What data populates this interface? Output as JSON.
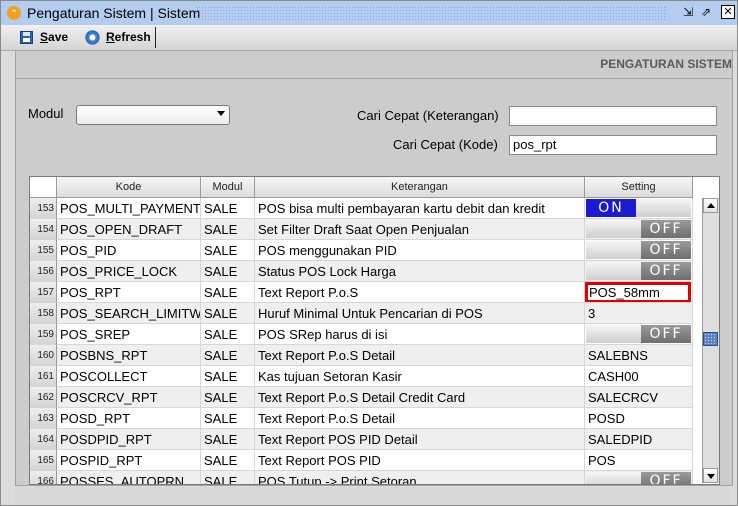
{
  "window": {
    "title": "Pengaturan Sistem | Sistem",
    "controls": {
      "minimize": "⇲",
      "maximize": "⇗",
      "close": "✕"
    }
  },
  "toolbar": {
    "save_prefix": "S",
    "save_rest": "ave",
    "refresh_prefix": "R",
    "refresh_rest": "efresh"
  },
  "panel": {
    "header": "PENGATURAN SISTEM",
    "modul_label": "Modul",
    "modul_value": "",
    "search_ket_label": "Cari Cepat (Keterangan)",
    "search_ket_value": "",
    "search_kode_label": "Cari Cepat (Kode)",
    "search_kode_value": "pos_rpt"
  },
  "table": {
    "columns": [
      "",
      "Kode",
      "Modul",
      "Keterangan",
      "Setting"
    ],
    "rows": [
      {
        "no": "153",
        "kode": "POS_MULTI_PAYMENT",
        "modul": "SALE",
        "ket": "POS bisa multi pembayaran kartu debit dan kredit",
        "type": "toggle",
        "setting": "ON"
      },
      {
        "no": "154",
        "kode": "POS_OPEN_DRAFT",
        "modul": "SALE",
        "ket": "Set Filter Draft Saat Open Penjualan",
        "type": "toggle",
        "setting": "OFF"
      },
      {
        "no": "155",
        "kode": "POS_PID",
        "modul": "SALE",
        "ket": "POS menggunakan PID",
        "type": "toggle",
        "setting": "OFF"
      },
      {
        "no": "156",
        "kode": "POS_PRICE_LOCK",
        "modul": "SALE",
        "ket": "Status POS Lock Harga",
        "type": "toggle",
        "setting": "OFF"
      },
      {
        "no": "157",
        "kode": "POS_RPT",
        "modul": "SALE",
        "ket": "Text Report P.o.S",
        "type": "text-highlight",
        "setting": "POS_58mm"
      },
      {
        "no": "158",
        "kode": "POS_SEARCH_LIMITW",
        "modul": "SALE",
        "ket": "Huruf Minimal Untuk Pencarian di POS",
        "type": "text",
        "setting": "3"
      },
      {
        "no": "159",
        "kode": "POS_SREP",
        "modul": "SALE",
        "ket": "POS SRep harus di isi",
        "type": "toggle",
        "setting": "OFF"
      },
      {
        "no": "160",
        "kode": "POSBNS_RPT",
        "modul": "SALE",
        "ket": "Text Report P.o.S Detail",
        "type": "text",
        "setting": "SALEBNS"
      },
      {
        "no": "161",
        "kode": "POSCOLLECT",
        "modul": "SALE",
        "ket": "Kas tujuan Setoran Kasir",
        "type": "text",
        "setting": "CASH00"
      },
      {
        "no": "162",
        "kode": "POSCRCV_RPT",
        "modul": "SALE",
        "ket": "Text Report P.o.S Detail Credit Card",
        "type": "text",
        "setting": "SALECRCV"
      },
      {
        "no": "163",
        "kode": "POSD_RPT",
        "modul": "SALE",
        "ket": "Text Report P.o.S Detail",
        "type": "text",
        "setting": "POSD"
      },
      {
        "no": "164",
        "kode": "POSDPID_RPT",
        "modul": "SALE",
        "ket": "Text Report POS PID Detail",
        "type": "text",
        "setting": "SALEDPID"
      },
      {
        "no": "165",
        "kode": "POSPID_RPT",
        "modul": "SALE",
        "ket": "Text Report POS PID",
        "type": "text",
        "setting": "POS"
      },
      {
        "no": "166",
        "kode": "POSSES_AUTOPRN",
        "modul": "SALE",
        "ket": "POS Tutup -> Print Setoran",
        "type": "toggle",
        "setting": "OFF"
      }
    ]
  },
  "colors": {
    "titlebar": "#b3cdf0",
    "toggle_on": "#1a1ad0",
    "highlight_border": "#e00000",
    "header_text": "#5a5a5a"
  }
}
